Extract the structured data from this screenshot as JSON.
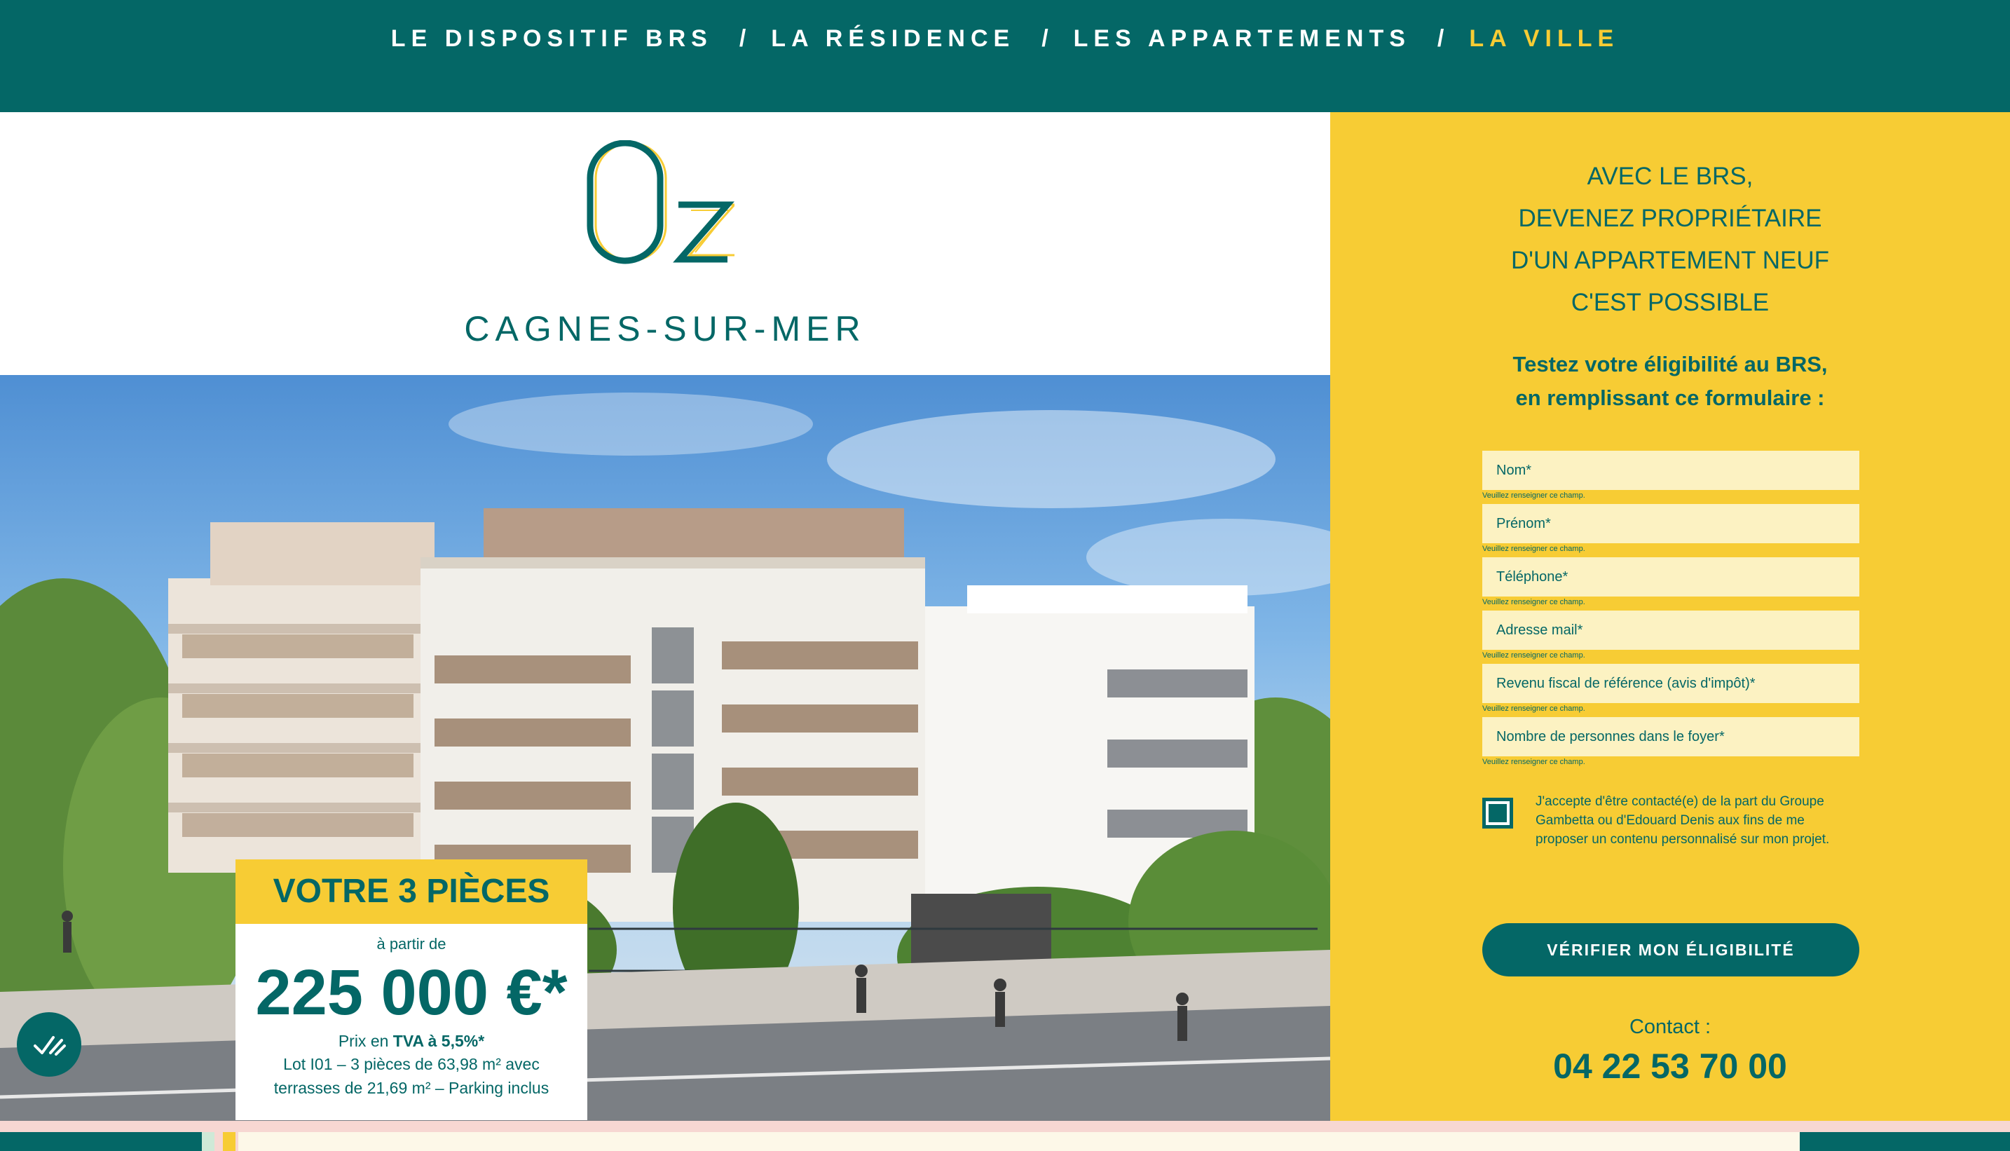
{
  "nav": {
    "items": [
      {
        "label": "LE DISPOSITIF BRS"
      },
      {
        "label": "LA RÉSIDENCE"
      },
      {
        "label": "LES APPARTEMENTS"
      },
      {
        "label": "LA VILLE"
      }
    ],
    "separator": "/"
  },
  "brand": {
    "city": "CAGNES-SUR-MER"
  },
  "offer": {
    "title": "VOTRE 3 PIÈCES",
    "from": "à partir de",
    "price": "225 000 €*",
    "tva_prefix": "Prix en ",
    "tva_bold": "TVA à 5,5%*",
    "lot_line1": "Lot I01 – 3 pièces de 63,98 m² avec",
    "lot_line2": "terrasses de 21,69 m² – Parking inclus"
  },
  "panel": {
    "tagline": [
      "AVEC LE BRS,",
      "DEVENEZ PROPRIÉTAIRE",
      "D'UN APPARTEMENT NEUF",
      "C'EST POSSIBLE"
    ],
    "subtitle": [
      "Testez votre éligibilité au BRS,",
      "en remplissant ce formulaire :"
    ],
    "form": {
      "fields": [
        {
          "placeholder": "Nom*",
          "error": "Veuillez renseigner ce champ."
        },
        {
          "placeholder": "Prénom*",
          "error": "Veuillez renseigner ce champ."
        },
        {
          "placeholder": "Téléphone*",
          "error": "Veuillez renseigner ce champ."
        },
        {
          "placeholder": "Adresse mail*",
          "error": "Veuillez renseigner ce champ."
        },
        {
          "placeholder": "Revenu fiscal de référence (avis d'impôt)*",
          "error": "Veuillez renseigner ce champ."
        },
        {
          "placeholder": "Nombre de personnes dans le foyer*",
          "error": "Veuillez renseigner ce champ."
        }
      ],
      "consent_label": "J'accepte d'être contacté(e) de la part du Groupe Gambetta ou d'Edouard Denis aux fins de me proposer un contenu personnalisé sur mon projet.",
      "consent_checked": true,
      "submit_label": "VÉRIFIER MON ÉLIGIBILITÉ"
    },
    "contact_label": "Contact :",
    "phone": "04 22 53 70 00"
  },
  "icons": {
    "fab": "accessibility-check-icon"
  },
  "colors": {
    "teal": "#046766",
    "yellow": "#f7cc34",
    "cream": "#fcf2c2",
    "pink": "#f7d7d2"
  }
}
